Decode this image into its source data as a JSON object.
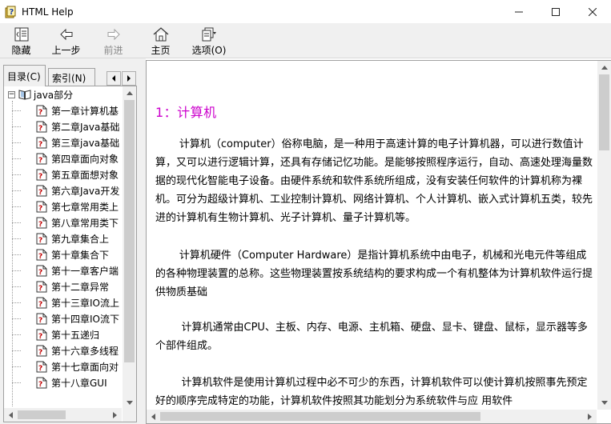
{
  "window": {
    "title": "HTML Help",
    "controls": [
      "minimize",
      "maximize",
      "close"
    ]
  },
  "toolbar": {
    "buttons": [
      {
        "label": "隐藏",
        "icon": "hide-pane-icon",
        "enabled": true
      },
      {
        "label": "上一步",
        "icon": "back-arrow-icon",
        "enabled": true
      },
      {
        "label": "前进",
        "icon": "forward-arrow-icon",
        "enabled": false
      },
      {
        "label": "主页",
        "icon": "home-icon",
        "enabled": true
      },
      {
        "label": "选项(O)",
        "icon": "options-icon",
        "enabled": true
      }
    ]
  },
  "navigation": {
    "tabs": [
      {
        "label": "目录(C)",
        "active": true
      },
      {
        "label": "索引(N)",
        "active": false
      }
    ],
    "tree": {
      "root": {
        "label": "java部分",
        "expanded": true
      },
      "items": [
        "第一章计算机基",
        "第二章Java基础",
        "第三章java基础",
        "第四章面向对象",
        "第五章面想对象",
        "第六章Java开发",
        "第七章常用类上",
        "第八章常用类下",
        "第九章集合上",
        "第十章集合下",
        "第十一章客户端",
        "第十二章异常",
        "第十三章IO流上",
        "第十四章IO流下",
        "第十五递归",
        "第十六章多线程",
        "第十七章面向对",
        "第十八章GUI"
      ]
    }
  },
  "content": {
    "heading": "1：计算机",
    "paragraphs": [
      "计算机（computer）俗称电脑，是一种用于高速计算的电子计算机器，可以进行数值计算，又可以进行逻辑计算，还具有存储记忆功能。是能够按照程序运行，自动、高速处理海量数据的现代化智能电子设备。由硬件系统和软件系统所组成，没有安装任何软件的计算机称为裸机。可分为超级计算机、工业控制计算机、网络计算机、个人计算机、嵌入式计算机五类，较先进的计算机有生物计算机、光子计算机、量子计算机等。",
      "计算机硬件（Computer Hardware）是指计算机系统中由电子，机械和光电元件等组成的各种物理装置的总称。这些物理装置按系统结构的要求构成一个有机整体为计算机软件运行提供物质基础",
      "计算机通常由CPU、主板、内存、电源、主机箱、硬盘、显卡、键盘、鼠标，显示器等多个部件组成。",
      "计算机软件是使用计算机过程中必不可少的东西，计算机软件可以使计算机按照事先预定好的顺序完成特定的功能，计算机软件按照其功能划分为系统软件与应 用软件"
    ]
  }
}
